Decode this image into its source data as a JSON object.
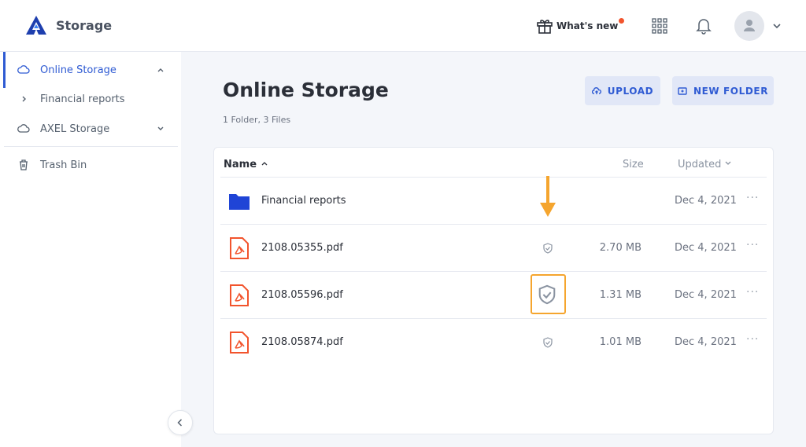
{
  "header": {
    "app_title": "Storage",
    "whats_new_label": "What's new",
    "notification_color": "#f2542d",
    "brand_color": "#2f5bd3"
  },
  "sidebar": {
    "items": [
      {
        "label": "Online Storage",
        "icon": "cloud-icon",
        "active": true,
        "expanded": true
      },
      {
        "label": "Financial reports",
        "icon": "chevron-right-icon"
      },
      {
        "label": "AXEL Storage",
        "icon": "cloud-icon",
        "expanded": false
      },
      {
        "label": "Trash Bin",
        "icon": "trash-icon"
      }
    ]
  },
  "main": {
    "title": "Online Storage",
    "subtitle": "1 Folder, 3 Files",
    "upload_label": "UPLOAD",
    "new_folder_label": "NEW FOLDER",
    "table": {
      "headers": {
        "name": "Name",
        "size": "Size",
        "updated": "Updated"
      },
      "rows": [
        {
          "name": "Financial reports",
          "type": "folder",
          "size": "",
          "date": "Dec 4, 2021",
          "shield": false
        },
        {
          "name": "2108.05355.pdf",
          "type": "pdf",
          "size": "2.70 MB",
          "date": "Dec 4, 2021",
          "shield": true
        },
        {
          "name": "2108.05596.pdf",
          "type": "pdf",
          "size": "1.31 MB",
          "date": "Dec 4, 2021",
          "shield": true,
          "highlighted": true
        },
        {
          "name": "2108.05874.pdf",
          "type": "pdf",
          "size": "1.01 MB",
          "date": "Dec 4, 2021",
          "shield": true
        }
      ],
      "more_label": "···"
    }
  },
  "annotation": {
    "color": "#f5a52e"
  }
}
